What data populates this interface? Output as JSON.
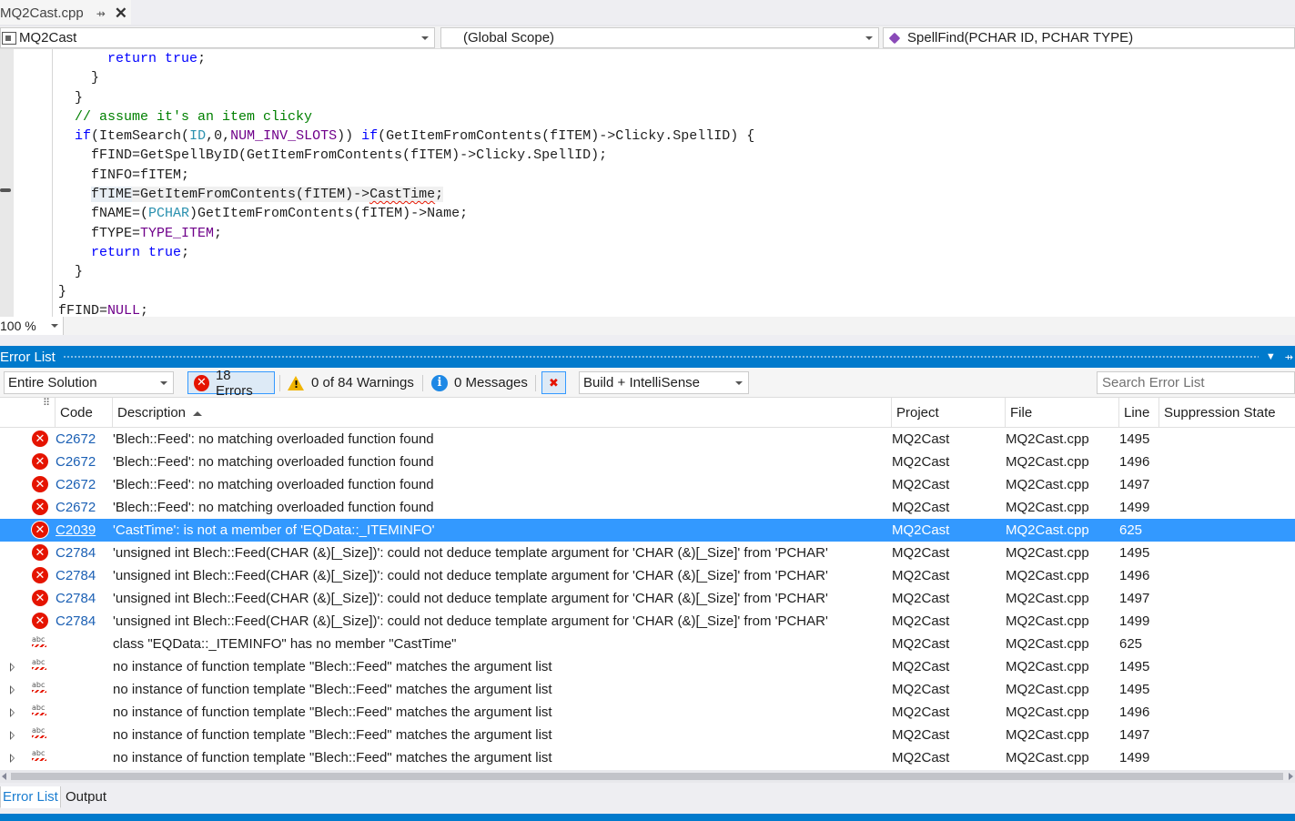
{
  "document_tab": {
    "name": "MQ2Cast.cpp",
    "pin": "⇸",
    "close": "✕"
  },
  "navbar": {
    "project": "MQ2Cast",
    "scope": "(Global Scope)",
    "member": "SpellFind(PCHAR ID, PCHAR TYPE)"
  },
  "code": [
    [
      {
        "t": "      "
      },
      {
        "t": "return",
        "c": "kw"
      },
      {
        "t": " "
      },
      {
        "t": "true",
        "c": "kw"
      },
      {
        "t": ";"
      }
    ],
    [
      {
        "t": "    }"
      }
    ],
    [
      {
        "t": "  }"
      }
    ],
    [
      {
        "t": "  "
      },
      {
        "t": "// assume it's an item clicky",
        "c": "cm"
      }
    ],
    [
      {
        "t": "  "
      },
      {
        "t": "if",
        "c": "kw"
      },
      {
        "t": "(ItemSearch("
      },
      {
        "t": "ID",
        "c": "ty"
      },
      {
        "t": ",0,"
      },
      {
        "t": "NUM_INV_SLOTS",
        "c": "mc"
      },
      {
        "t": ")) "
      },
      {
        "t": "if",
        "c": "kw"
      },
      {
        "t": "(GetItemFromContents(fITEM)->Clicky.SpellID) {"
      }
    ],
    [
      {
        "t": "    fFIND=GetSpellByID(GetItemFromContents(fITEM)->Clicky.SpellID);"
      }
    ],
    [
      {
        "t": "    fINFO=fITEM;"
      }
    ],
    [
      {
        "t": "    "
      },
      {
        "t": "fTIME",
        "c": "hl-name"
      },
      {
        "t": "=GetItemFromContents(fITEM)->",
        "c": "hl-all"
      },
      {
        "t": "CastTime",
        "c": "hl-all squig"
      },
      {
        "t": ";",
        "c": "hl-all"
      }
    ],
    [
      {
        "t": "    fNAME=("
      },
      {
        "t": "PCHAR",
        "c": "ty"
      },
      {
        "t": ")GetItemFromContents(fITEM)->Name;"
      }
    ],
    [
      {
        "t": "    fTYPE="
      },
      {
        "t": "TYPE_ITEM",
        "c": "mc"
      },
      {
        "t": ";"
      }
    ],
    [
      {
        "t": "    "
      },
      {
        "t": "return",
        "c": "kw"
      },
      {
        "t": " "
      },
      {
        "t": "true",
        "c": "kw"
      },
      {
        "t": ";"
      }
    ],
    [
      {
        "t": "  }"
      }
    ],
    [
      {
        "t": "}"
      }
    ],
    [
      {
        "t": "fFIND="
      },
      {
        "t": "NULL",
        "c": "mc"
      },
      {
        "t": ";"
      }
    ]
  ],
  "zoom": "100 %",
  "panel": {
    "title": "Error List",
    "scope_filter": "Entire Solution",
    "errors_label": "18 Errors",
    "warnings_label": "0 of 84 Warnings",
    "messages_label": "0 Messages",
    "build_filter": "Build + IntelliSense",
    "search_placeholder": "Search Error List",
    "columns": {
      "code": "Code",
      "description": "Description",
      "project": "Project",
      "file": "File",
      "line": "Line",
      "suppression": "Suppression State"
    }
  },
  "rows": [
    {
      "icon": "error",
      "expand": false,
      "code": "C2672",
      "description": "'Blech::Feed': no matching overloaded function found",
      "project": "MQ2Cast",
      "file": "MQ2Cast.cpp",
      "line": "1495"
    },
    {
      "icon": "error",
      "expand": false,
      "code": "C2672",
      "description": "'Blech::Feed': no matching overloaded function found",
      "project": "MQ2Cast",
      "file": "MQ2Cast.cpp",
      "line": "1496"
    },
    {
      "icon": "error",
      "expand": false,
      "code": "C2672",
      "description": "'Blech::Feed': no matching overloaded function found",
      "project": "MQ2Cast",
      "file": "MQ2Cast.cpp",
      "line": "1497"
    },
    {
      "icon": "error",
      "expand": false,
      "code": "C2672",
      "description": "'Blech::Feed': no matching overloaded function found",
      "project": "MQ2Cast",
      "file": "MQ2Cast.cpp",
      "line": "1499"
    },
    {
      "icon": "error",
      "expand": false,
      "code": "C2039",
      "description": "'CastTime': is not a member of 'EQData::_ITEMINFO'",
      "project": "MQ2Cast",
      "file": "MQ2Cast.cpp",
      "line": "625",
      "selected": true
    },
    {
      "icon": "error",
      "expand": false,
      "code": "C2784",
      "description": "'unsigned int Blech::Feed(CHAR (&)[_Size])': could not deduce template argument for 'CHAR (&)[_Size]' from 'PCHAR'",
      "project": "MQ2Cast",
      "file": "MQ2Cast.cpp",
      "line": "1495"
    },
    {
      "icon": "error",
      "expand": false,
      "code": "C2784",
      "description": "'unsigned int Blech::Feed(CHAR (&)[_Size])': could not deduce template argument for 'CHAR (&)[_Size]' from 'PCHAR'",
      "project": "MQ2Cast",
      "file": "MQ2Cast.cpp",
      "line": "1496"
    },
    {
      "icon": "error",
      "expand": false,
      "code": "C2784",
      "description": "'unsigned int Blech::Feed(CHAR (&)[_Size])': could not deduce template argument for 'CHAR (&)[_Size]' from 'PCHAR'",
      "project": "MQ2Cast",
      "file": "MQ2Cast.cpp",
      "line": "1497"
    },
    {
      "icon": "error",
      "expand": false,
      "code": "C2784",
      "description": "'unsigned int Blech::Feed(CHAR (&)[_Size])': could not deduce template argument for 'CHAR (&)[_Size]' from 'PCHAR'",
      "project": "MQ2Cast",
      "file": "MQ2Cast.cpp",
      "line": "1499"
    },
    {
      "icon": "intellisense",
      "expand": false,
      "code": "",
      "description": "class \"EQData::_ITEMINFO\" has no member \"CastTime\"",
      "project": "MQ2Cast",
      "file": "MQ2Cast.cpp",
      "line": "625"
    },
    {
      "icon": "intellisense",
      "expand": true,
      "code": "",
      "description": "no instance of function template \"Blech::Feed\" matches the argument list",
      "project": "MQ2Cast",
      "file": "MQ2Cast.cpp",
      "line": "1495"
    },
    {
      "icon": "intellisense",
      "expand": true,
      "code": "",
      "description": "no instance of function template \"Blech::Feed\" matches the argument list",
      "project": "MQ2Cast",
      "file": "MQ2Cast.cpp",
      "line": "1495"
    },
    {
      "icon": "intellisense",
      "expand": true,
      "code": "",
      "description": "no instance of function template \"Blech::Feed\" matches the argument list",
      "project": "MQ2Cast",
      "file": "MQ2Cast.cpp",
      "line": "1496"
    },
    {
      "icon": "intellisense",
      "expand": true,
      "code": "",
      "description": "no instance of function template \"Blech::Feed\" matches the argument list",
      "project": "MQ2Cast",
      "file": "MQ2Cast.cpp",
      "line": "1497"
    },
    {
      "icon": "intellisense",
      "expand": true,
      "code": "",
      "description": "no instance of function template \"Blech::Feed\" matches the argument list",
      "project": "MQ2Cast",
      "file": "MQ2Cast.cpp",
      "line": "1499"
    }
  ],
  "bottom_tabs": [
    {
      "label": "Error List",
      "active": true
    },
    {
      "label": "Output",
      "active": false
    }
  ],
  "icons": {
    "error": "✕",
    "info": "i",
    "filter": "✖",
    "abc": "abc",
    "panel_menu": "▼",
    "panel_pin": "⇸"
  }
}
